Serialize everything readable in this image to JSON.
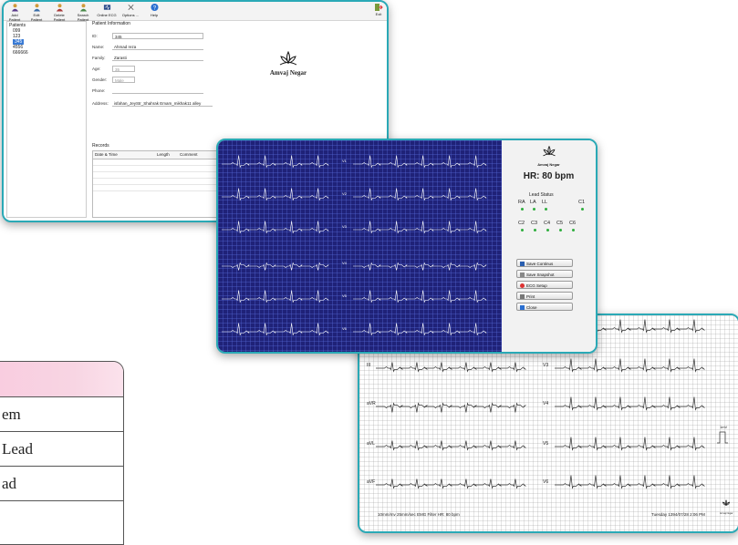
{
  "toolbar": {
    "buttons": [
      "Add Patient",
      "Edit Patient",
      "Delete Patient",
      "Search Patient",
      "Online ECG",
      "Options ...",
      "Help"
    ],
    "exit": "Exit"
  },
  "tree": {
    "root": "Patients",
    "items": [
      "099",
      "123",
      "345",
      "4556",
      "666666"
    ],
    "selected_index": 2
  },
  "patient_info": {
    "title": "Patient Information",
    "labels": {
      "id": "ID:",
      "name": "Name:",
      "family": "Family:",
      "age": "Age:",
      "gender": "Gender:",
      "phone": "Phone:",
      "address": "Address:"
    },
    "values": {
      "id": "345",
      "name": "Ahmad reza",
      "family": "Zarasti",
      "age": "35",
      "gender": "Male",
      "phone": "",
      "address": "isfahan_JeyStr_Shahrak Emam_mikhak11 alley"
    }
  },
  "records": {
    "title": "Records",
    "columns": [
      "Date & Time",
      "Length",
      "Comment"
    ]
  },
  "brand": {
    "name": "Amvaj Negar"
  },
  "monitor": {
    "brand": "Amvaj Negar",
    "hr": "HR: 80 bpm",
    "lead_status_title": "Lead Status",
    "leads_top": [
      "RA",
      "LA",
      "LL",
      "C1"
    ],
    "leads_bottom": [
      "C2",
      "C3",
      "C4",
      "C5",
      "C6"
    ],
    "trace_labels": [
      "V1",
      "V2",
      "V3",
      "V4",
      "V5",
      "V6"
    ],
    "buttons": [
      "Save Continus",
      "Save Snapshot",
      "ECG Setup",
      "Print",
      "Close"
    ]
  },
  "printout": {
    "left_labels": [
      "III",
      "aVR",
      "aVL",
      "aVF"
    ],
    "right_labels": [
      "V3",
      "V4",
      "V5",
      "V6"
    ],
    "calibration": "1mV",
    "footer_left": "10mm/mv  25mm/sec  EMG Filter  HR: 80 bpm",
    "footer_right": "Tuesday 1394/07/28 2:06 PM",
    "logo_text": "Amvaj Negar"
  },
  "table": {
    "rows": [
      "em",
      "Lead",
      "ad"
    ]
  },
  "colors": {
    "frame": "#2aa9b6",
    "ecg_bg": "#1f2278",
    "table_header": "#f8d5e3",
    "lead_ok": "#2fae3e"
  }
}
